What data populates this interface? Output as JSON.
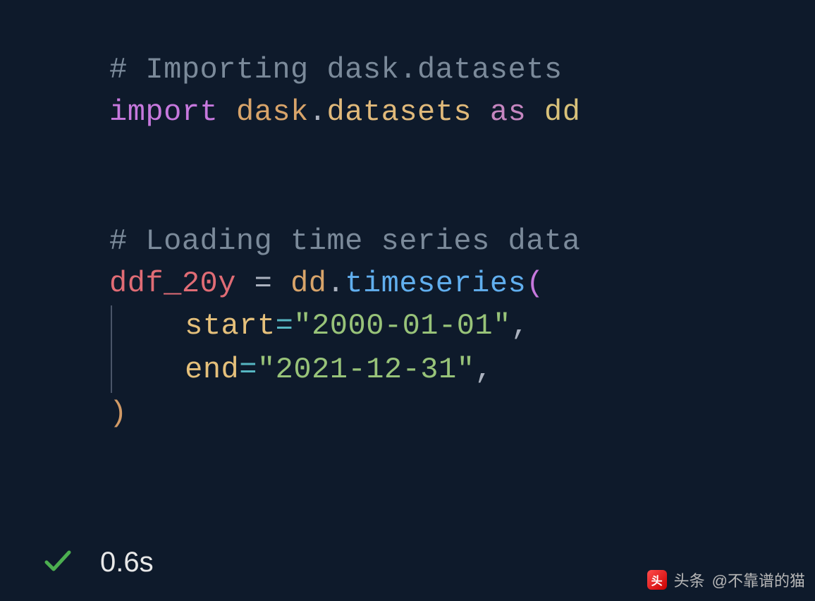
{
  "code": {
    "comment1": "# Importing dask.datasets",
    "import_kw": "import",
    "module_a": "dask",
    "module_b": "datasets",
    "as_kw": "as",
    "alias": "dd",
    "comment2": "# Loading time series data",
    "var": "ddf_20y",
    "assign": "=",
    "obj": "dd",
    "func": "timeseries",
    "param_start": "start",
    "val_start": "\"2000-01-01\"",
    "param_end": "end",
    "val_end": "\"2021-12-31\""
  },
  "status": {
    "timing": "0.6s"
  },
  "watermark": {
    "brand": "头条",
    "user": "@不靠谱的猫"
  }
}
